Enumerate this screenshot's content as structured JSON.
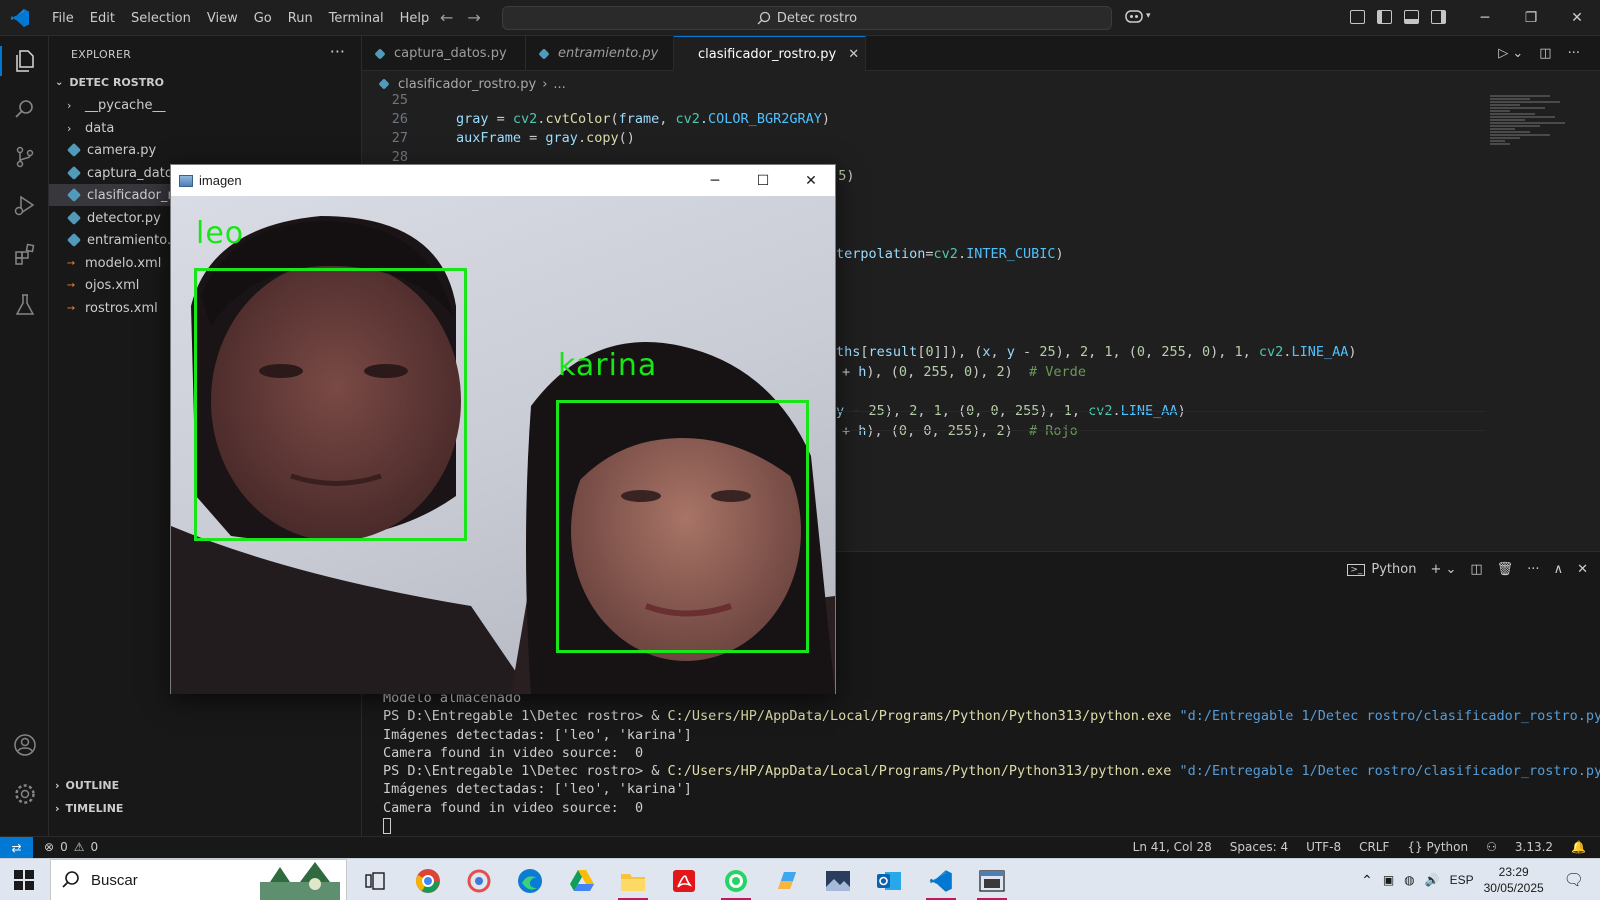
{
  "titlebar": {
    "menu": [
      "File",
      "Edit",
      "Selection",
      "View",
      "Go",
      "Run",
      "Terminal",
      "Help"
    ],
    "search_text": "Detec rostro"
  },
  "sidebar": {
    "header": "EXPLORER",
    "root": "DETEC ROSTRO",
    "items": [
      {
        "label": "__pycache__",
        "type": "folder"
      },
      {
        "label": "data",
        "type": "folder"
      },
      {
        "label": "camera.py",
        "type": "py"
      },
      {
        "label": "captura_datos",
        "type": "py"
      },
      {
        "label": "clasificador_ro",
        "type": "py"
      },
      {
        "label": "detector.py",
        "type": "py"
      },
      {
        "label": "entramiento.p",
        "type": "py"
      },
      {
        "label": "modelo.xml",
        "type": "xml"
      },
      {
        "label": "ojos.xml",
        "type": "xml"
      },
      {
        "label": "rostros.xml",
        "type": "xml"
      }
    ],
    "outline": "OUTLINE",
    "timeline": "TIMELINE"
  },
  "tabs": [
    {
      "label": "captura_datos.py"
    },
    {
      "label": "entramiento.py"
    },
    {
      "label": "clasificador_rostro.py"
    }
  ],
  "breadcrumb": {
    "file": "clasificador_rostro.py",
    "rest": "..."
  },
  "editor": {
    "line_numbers": [
      "25",
      "26",
      "27",
      "28"
    ],
    "l26_a": "gray",
    "l26_b": " = ",
    "l26_c": "cv2",
    "l26_d": ".",
    "l26_e": "cvtColor",
    "l26_f": "(",
    "l26_g": "frame",
    "l26_h": ", ",
    "l26_i": "cv2",
    "l26_j": ".",
    "l26_k": "COLOR_BGR2GRAY",
    "l26_l": ")",
    "l27_a": "auxFrame",
    "l27_b": " = ",
    "l27_c": "gray",
    "l27_d": ".",
    "l27_e": "copy",
    "l27_f": "()",
    "frag1_a": ", ",
    "frag1_b": "5",
    "frag1_c": ")",
    "frag2_a": "terpolation",
    "frag2_b": "=",
    "frag2_c": "cv2",
    "frag2_d": ".",
    "frag2_e": "INTER_CUBIC",
    "frag2_f": ")",
    "frag3_a": "ths",
    "frag3_b": "[",
    "frag3_c": "result",
    "frag3_d": "[",
    "frag3_e": "0",
    "frag3_f": "]]), (",
    "frag3_g": "x",
    "frag3_h": ", ",
    "frag3_i": "y",
    "frag3_j": " - ",
    "frag3_k": "25",
    "frag3_l": "), ",
    "frag3_m": "2",
    "frag3_n": ", ",
    "frag3_o": "1",
    "frag3_p": ", (",
    "frag3_q": "0",
    "frag3_r": ", ",
    "frag3_s": "255",
    "frag3_t": ", ",
    "frag3_u": "0",
    "frag3_v": "), ",
    "frag3_w": "1",
    "frag3_x": ", ",
    "frag3_y": "cv2",
    "frag3_z": ".",
    "frag3_aa": "LINE_AA",
    "frag3_ab": ")",
    "frag4_a": "+ ",
    "frag4_b": "h",
    "frag4_c": "), (",
    "frag4_d": "0",
    "frag4_e": ", ",
    "frag4_f": "255",
    "frag4_g": ", ",
    "frag4_h": "0",
    "frag4_i": "), ",
    "frag4_j": "2",
    "frag4_k": ")  ",
    "frag4_l": "# Verde",
    "frag5_a": "y",
    "frag5_b": " - ",
    "frag5_c": "25",
    "frag5_d": "), ",
    "frag5_e": "2",
    "frag5_f": ", ",
    "frag5_g": "1",
    "frag5_h": ", (",
    "frag5_i": "0",
    "frag5_j": ", ",
    "frag5_k": "0",
    "frag5_l": ", ",
    "frag5_m": "255",
    "frag5_n": "), ",
    "frag5_o": "1",
    "frag5_p": ", ",
    "frag5_q": "cv2",
    "frag5_r": ".",
    "frag5_s": "LINE_AA",
    "frag5_t": ")",
    "frag6_a": "+ ",
    "frag6_b": "h",
    "frag6_c": "), (",
    "frag6_d": "0",
    "frag6_e": ", ",
    "frag6_f": "0",
    "frag6_g": ", ",
    "frag6_h": "255",
    "frag6_i": "), ",
    "frag6_j": "2",
    "frag6_k": ")  ",
    "frag6_l": "# Rojo"
  },
  "panel": {
    "terminal_name": "Python",
    "lines": {
      "l1": "Modelo almacenado",
      "l2_prompt": "PS D:\\Entregable 1\\Detec rostro> & ",
      "l2_exe": "C:/Users/HP/AppData/Local/Programs/Python/Python313/python.exe",
      "l2_space": " ",
      "l2_script": "\"d:/Entregable 1/Detec rostro/clasificador_rostro.py\"",
      "l3": "Imágenes detectadas: ['leo', 'karina']",
      "l4": "Camera found in video source:  0",
      "l5_prompt": "PS D:\\Entregable 1\\Detec rostro> & ",
      "l5_exe": "C:/Users/HP/AppData/Local/Programs/Python/Python313/python.exe",
      "l5_space": " ",
      "l5_script": "\"d:/Entregable 1/Detec rostro/clasificador_rostro.py\"",
      "l6": "Imágenes detectadas: ['leo', 'karina']",
      "l7": "Camera found in video source:  0"
    }
  },
  "statusbar": {
    "errors": "0",
    "warnings": "0",
    "position": "Ln 41, Col 28",
    "spaces": "Spaces: 4",
    "encoding": "UTF-8",
    "eol": "CRLF",
    "language": "Python",
    "version": "3.13.2"
  },
  "cv_window": {
    "title": "imagen",
    "labels": [
      "leo",
      "karina"
    ]
  },
  "taskbar": {
    "search_placeholder": "Buscar",
    "lang": "ESP",
    "time": "23:29",
    "date": "30/05/2025"
  },
  "colors": {
    "accent": "#0078d4",
    "box_green": "#19e619"
  }
}
